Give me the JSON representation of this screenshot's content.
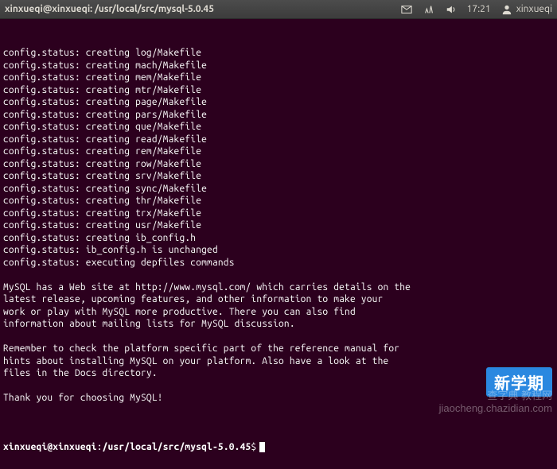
{
  "menubar": {
    "title": "xinxueqi@xinxueqi: /usr/local/src/mysql-5.0.45",
    "clock": "17:21",
    "username": "xinxueqi"
  },
  "terminal": {
    "lines": [
      "config.status: creating log/Makefile",
      "config.status: creating mach/Makefile",
      "config.status: creating mem/Makefile",
      "config.status: creating mtr/Makefile",
      "config.status: creating page/Makefile",
      "config.status: creating pars/Makefile",
      "config.status: creating que/Makefile",
      "config.status: creating read/Makefile",
      "config.status: creating rem/Makefile",
      "config.status: creating row/Makefile",
      "config.status: creating srv/Makefile",
      "config.status: creating sync/Makefile",
      "config.status: creating thr/Makefile",
      "config.status: creating trx/Makefile",
      "config.status: creating usr/Makefile",
      "config.status: creating ib_config.h",
      "config.status: ib_config.h is unchanged",
      "config.status: executing depfiles commands",
      "",
      "MySQL has a Web site at http://www.mysql.com/ which carries details on the",
      "latest release, upcoming features, and other information to make your",
      "work or play with MySQL more productive. There you can also find",
      "information about mailing lists for MySQL discussion.",
      "",
      "Remember to check the platform specific part of the reference manual for",
      "hints about installing MySQL on your platform. Also have a look at the",
      "files in the Docs directory.",
      "",
      "Thank you for choosing MySQL!",
      ""
    ],
    "prompt_user": "xinxueqi@xinxueqi",
    "prompt_path": "/usr/local/src/mysql-5.0.45",
    "prompt_symbol": "$"
  },
  "overlay": {
    "badge": "新学期",
    "watermark_line1": "查字典    教程网",
    "watermark_line2": "jiaocheng.chazidian.com"
  }
}
